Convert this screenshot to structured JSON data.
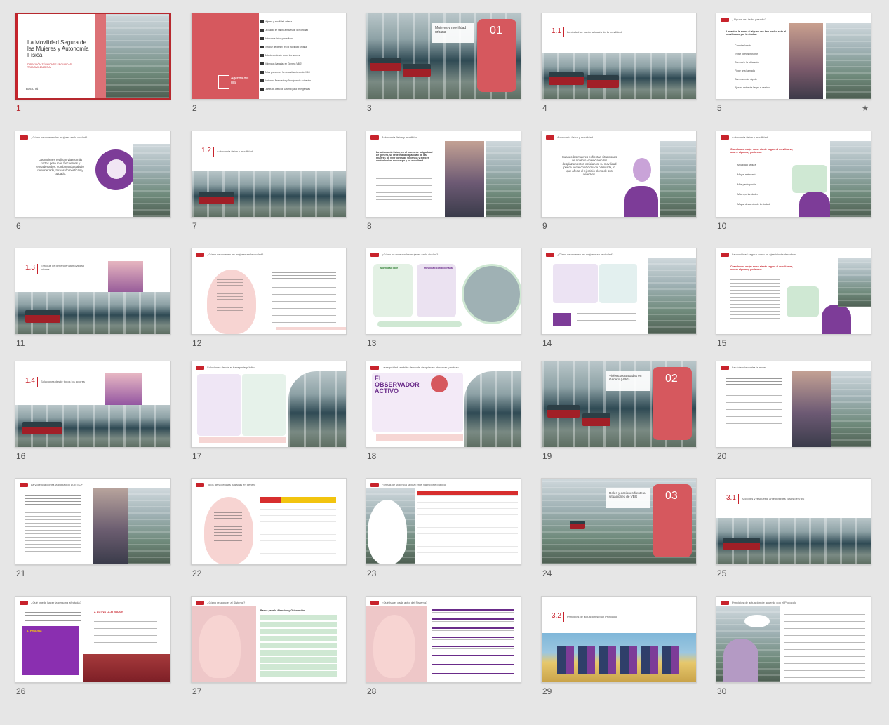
{
  "app": {
    "view": "slide-sorter"
  },
  "slides": [
    {
      "n": "1",
      "selected": true,
      "title": "La Movilidad Segura de las Mujeres y Autonomía Física",
      "sub": "DIRECCIÓN TÉCNICA DE SEGURIDAD TRANSMILENIO S.A.",
      "logos": "BOGOTÁ"
    },
    {
      "n": "2",
      "agenda": "Agenda del día",
      "items": [
        "Mujeres y movilidad urbana",
        "La ciudad se habita a través de la movilidad",
        "Autonomía física y movilidad",
        "Enfoque de género en la movilidad urbana",
        "Soluciones desde todos los actores",
        "Violencias Basadas en Género (VBG)",
        "Roles y acciones frente a situaciones de VBG",
        "Acciones, Respuesta y Principios de actuación",
        "Líneas de Atención Distrital para emergencias"
      ]
    },
    {
      "n": "3",
      "title": "Mujeres y movilidad urbana",
      "badge": "01"
    },
    {
      "n": "4",
      "sec": "1.1",
      "title": "La ciudad se habita a través de la movilidad"
    },
    {
      "n": "5",
      "star": "★",
      "title": "¿Alguna vez te ha pasado?",
      "lead": "Levanten la mano si alguna vez han hecho esto al movilizarse por la ciudad:",
      "items": [
        "Cambiar la ruta",
        "Evitar ciertos horarios",
        "Compartir la ubicación",
        "Fingir una llamada",
        "Caminar más rápido",
        "Ajustar antes de llegar a destino"
      ]
    },
    {
      "n": "6",
      "title": "¿Cómo se mueven las mujeres en la ciudad?",
      "text": "Las mujeres realizan viajes más cortos pero más frecuentes y encadenados, combinando trabajo remunerado, tareas domésticas y cuidado."
    },
    {
      "n": "7",
      "sec": "1.2",
      "title": "Autonomía física y movilidad"
    },
    {
      "n": "8",
      "title": "Autonomía física y movilidad",
      "lead": "La autonomía física, en el marco de la igualdad de género, se refiere a la capacidad de las mujeres de vivir libres de violencia y ejercer control sobre su cuerpo y su movilidad."
    },
    {
      "n": "9",
      "title": "Autonomía física y movilidad",
      "text": "Cuando las mujeres enfrentan situaciones de acoso o violencia en los desplazamientos cotidianos, su movilidad puede verse condicionada o limitada, lo que afecta el ejercicio pleno de sus derechos."
    },
    {
      "n": "10",
      "title": "Autonomía física y movilidad",
      "lead": "Cuando una mujer no se siente segura al movilizarse, ocurre algo muy poderoso:",
      "items": [
        "Movilidad segura",
        "Mayor autonomía",
        "Más participación",
        "Más oportunidades",
        "Mayor desarrollo de la ciudad"
      ]
    },
    {
      "n": "11",
      "sec": "1.3",
      "title": "Enfoque de género en la movilidad urbana"
    },
    {
      "n": "12",
      "title": "¿Cómo se mueven las mujeres en la ciudad?"
    },
    {
      "n": "13",
      "title": "¿Cómo se mueven las mujeres en la ciudad?",
      "a": "Movilidad libre",
      "b": "Movilidad condicionada"
    },
    {
      "n": "14",
      "title": "¿Cómo se mueven las mujeres en la ciudad?"
    },
    {
      "n": "15",
      "title": "La movilidad segura como un ejercicio de derechos",
      "lead": "Cuando una mujer no se siente segura al movilizarse, ocurre algo muy poderoso:"
    },
    {
      "n": "16",
      "sec": "1.4",
      "title": "Soluciones desde todos los actores"
    },
    {
      "n": "17",
      "title": "Soluciones desde el transporte público"
    },
    {
      "n": "18",
      "title": "La seguridad también depende de quienes observan y actúan",
      "banner": "EL OBSERVADOR ACTIVO"
    },
    {
      "n": "19",
      "title": "Violencias Basadas en Género (VBG)",
      "badge": "02"
    },
    {
      "n": "20",
      "title": "La violencia contra la mujer"
    },
    {
      "n": "21",
      "title": "La violencia contra la población LGBTIQ+"
    },
    {
      "n": "22",
      "title": "Tipos de violencias basadas en género"
    },
    {
      "n": "23",
      "title": "Formas de violencia sexual en el transporte público"
    },
    {
      "n": "24",
      "title": "Roles y acciones frente a situaciones de VBG",
      "badge": "03"
    },
    {
      "n": "25",
      "sec": "3.1",
      "title": "Acciones y respuesta ante posibles casos de VBG"
    },
    {
      "n": "26",
      "title": "¿Qué puede hacer la persona afectada?",
      "box": "1. Reporta",
      "act": "2. ACTIVA LA ATENCIÓN"
    },
    {
      "n": "27",
      "title": "¿Cómo responder al Sistema?",
      "head": "Pasos para la Atención y Orientación"
    },
    {
      "n": "28",
      "title": "¿Qué hacer cada actor del Sistema?"
    },
    {
      "n": "29",
      "sec": "3.2",
      "title": "Principios de actuación según Protocolo"
    },
    {
      "n": "30",
      "title": "Principios de actuación de acuerdo con el Protocolo"
    }
  ],
  "colors": {
    "accent": "#c8232c",
    "pink": "#d6585e",
    "lightpink": "#f6d6d4",
    "purple": "#7d3c98"
  }
}
